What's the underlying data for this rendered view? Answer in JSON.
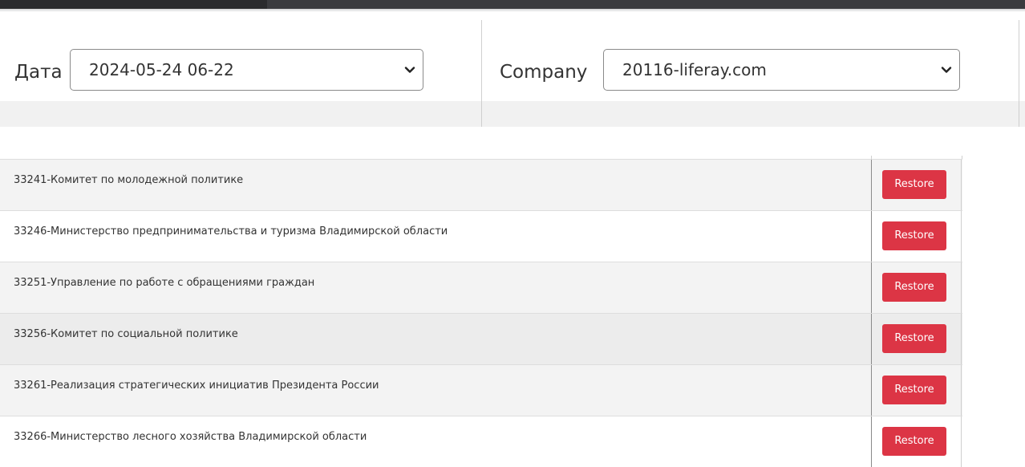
{
  "filters": {
    "date": {
      "label": "Дата",
      "value": "2024-05-24 06-22",
      "icon": "chevron-down-icon"
    },
    "company": {
      "label": "Company",
      "value": "20116-liferay.com",
      "icon": "chevron-down-icon"
    }
  },
  "colors": {
    "topbar": "#3a3b3f",
    "restore_button": "#dc3545",
    "row_alt": "#f3f3f3"
  },
  "list": {
    "action_label": "Restore",
    "rows": [
      {
        "name": "33241-Комитет по молодежной политике"
      },
      {
        "name": "33246-Министерство предпринимательства и туризма Владимирской области"
      },
      {
        "name": "33251-Управление по работе с обращениями граждан"
      },
      {
        "name": "33256-Комитет по социальной политике"
      },
      {
        "name": "33261-Реализация стратегических инициатив Президента России"
      },
      {
        "name": "33266-Министерство лесного хозяйства Владимирской области"
      }
    ]
  }
}
